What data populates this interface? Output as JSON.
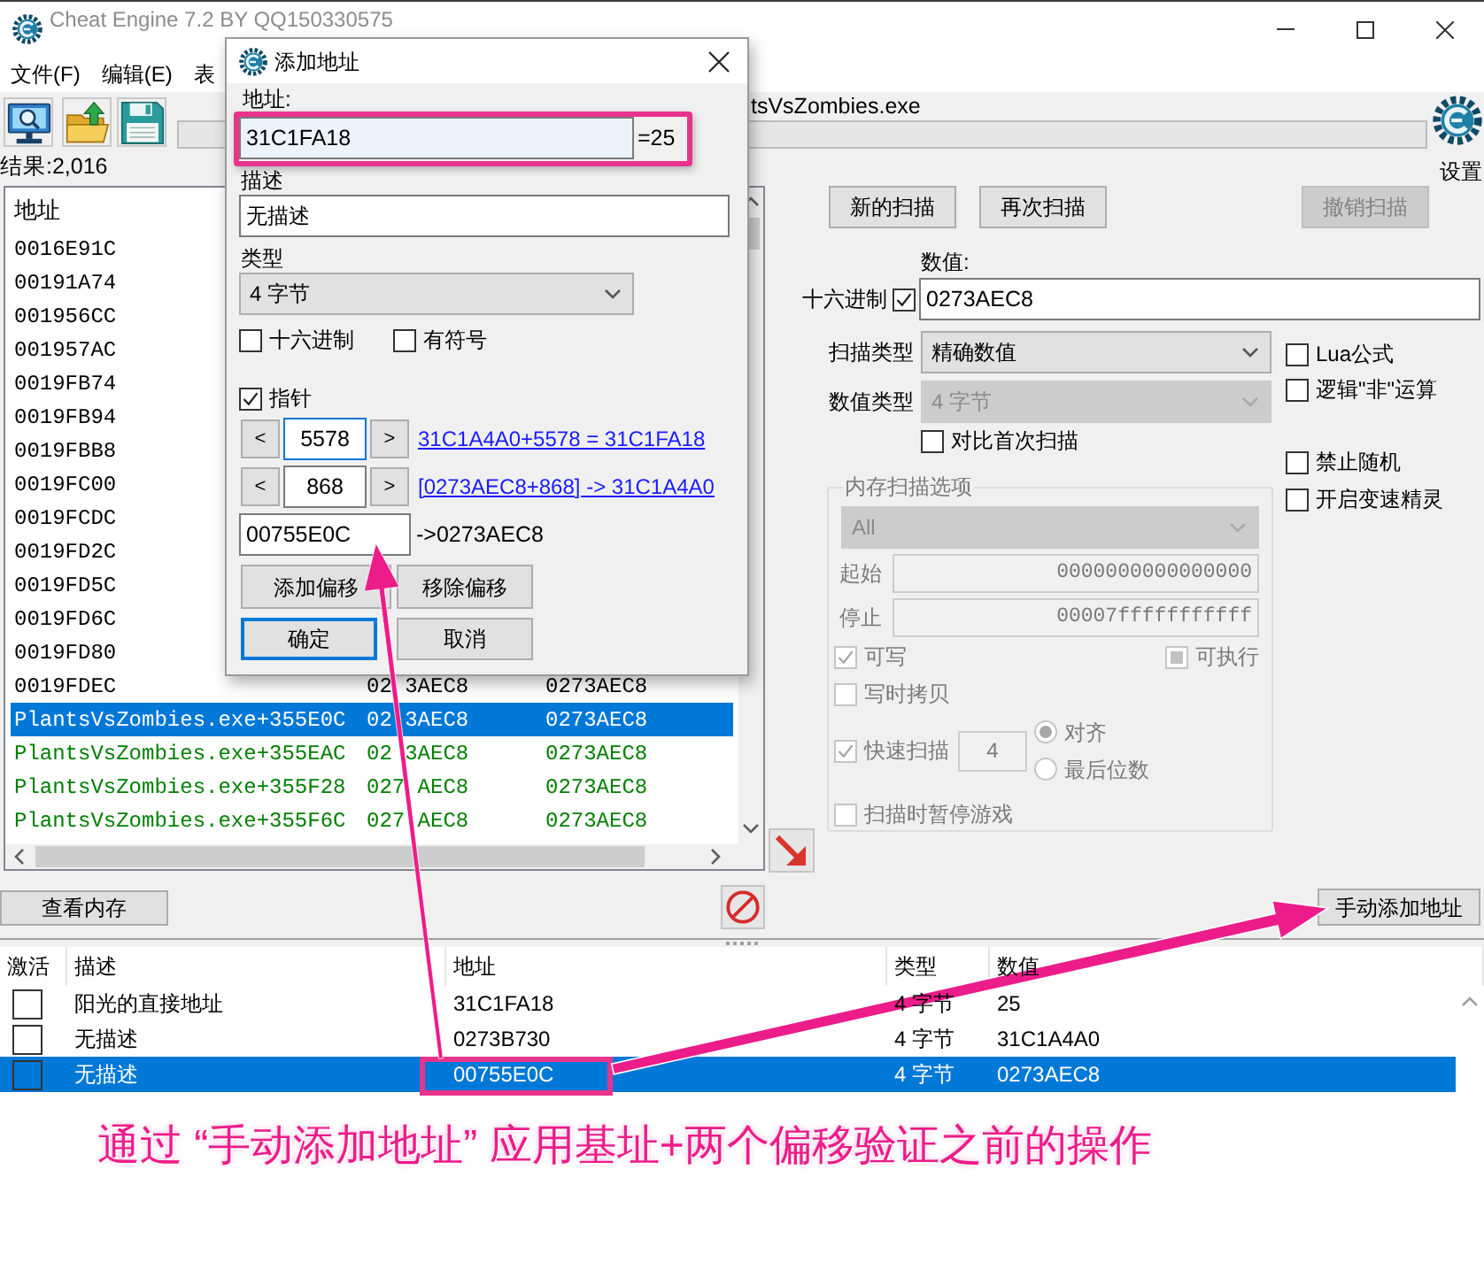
{
  "window": {
    "title": "Cheat Engine 7.2 BY QQ150330575"
  },
  "menu": [
    "文件(F)",
    "编辑(E)",
    "表"
  ],
  "process": {
    "name": "tsVsZombies.exe"
  },
  "progress": {
    "level": 0
  },
  "settings_label": "设置",
  "found": "结果:2,016",
  "results": {
    "columns": [
      "地址"
    ],
    "rows": [
      {
        "address": "0016E91C",
        "kind": "normal",
        "selected": false
      },
      {
        "address": "00191A74",
        "kind": "normal",
        "selected": false
      },
      {
        "address": "001956CC",
        "kind": "normal",
        "selected": false
      },
      {
        "address": "001957AC",
        "kind": "normal",
        "selected": false
      },
      {
        "address": "0019FB74",
        "kind": "normal",
        "selected": false
      },
      {
        "address": "0019FB94",
        "kind": "normal",
        "selected": false
      },
      {
        "address": "0019FBB8",
        "kind": "normal",
        "selected": false
      },
      {
        "address": "0019FC00",
        "kind": "normal",
        "selected": false
      },
      {
        "address": "0019FCDC",
        "kind": "normal",
        "selected": false
      },
      {
        "address": "0019FD2C",
        "kind": "normal",
        "selected": false
      },
      {
        "address": "0019FD5C",
        "kind": "normal",
        "selected": false
      },
      {
        "address": "0019FD6C",
        "kind": "normal",
        "selected": false
      },
      {
        "address": "0019FD80",
        "kind": "normal",
        "selected": false
      },
      {
        "address": "0019FDEC",
        "value_parts": [
          "02",
          "3AEC8"
        ],
        "previous": "0273AEC8",
        "kind": "normal",
        "selected": false
      },
      {
        "address": "PlantsVsZombies.exe+355E0C",
        "value_parts": [
          "02",
          "3AEC8"
        ],
        "previous": "0273AEC8",
        "selected": true
      },
      {
        "address": "PlantsVsZombies.exe+355EAC",
        "value_parts": [
          "02",
          "3AEC8"
        ],
        "previous": "0273AEC8",
        "kind": "static",
        "selected": false
      },
      {
        "address": "PlantsVsZombies.exe+355F28",
        "value_parts": [
          "027",
          "AEC8"
        ],
        "previous": "0273AEC8",
        "kind": "static",
        "selected": false
      },
      {
        "address": "PlantsVsZombies.exe+355F6C",
        "value_parts": [
          "027",
          "AEC8"
        ],
        "previous": "0273AEC8",
        "kind": "static",
        "selected": false
      }
    ]
  },
  "view_memory": "查看内存",
  "add_address": "手动添加地址",
  "scan": {
    "buttons": [
      {
        "label": "新的扫描",
        "disabled": false
      },
      {
        "label": "再次扫描",
        "disabled": false
      },
      {
        "label": "撤销扫描",
        "disabled": true
      }
    ],
    "value_label": "数值:",
    "hex": {
      "label": "十六进制",
      "checked": true
    },
    "value": "0273AEC8",
    "scan_type": {
      "label": "扫描类型",
      "value": "精确数值",
      "disabled": false
    },
    "value_type": {
      "label": "数值类型",
      "value": "4 字节",
      "disabled": true
    },
    "compare_first": {
      "label": "对比首次扫描",
      "checked": false
    },
    "option_groups": [
      [
        {
          "label": "Lua公式",
          "checked": false
        },
        {
          "label": "逻辑\"非\"运算",
          "checked": false
        }
      ],
      [
        {
          "label": "禁止随机",
          "checked": false
        },
        {
          "label": "开启变速精灵",
          "checked": false
        }
      ]
    ],
    "memory_options": {
      "title": "内存扫描选项",
      "disabled": true,
      "region": "All",
      "start_label": "起始",
      "start": "0000000000000000",
      "stop_label": "停止",
      "stop": "00007fffffffffff",
      "writable": {
        "label": "可写",
        "checked": true
      },
      "executable": {
        "label": "可执行",
        "checked": false,
        "partial": true
      },
      "copy_on_write": {
        "label": "写时拷贝",
        "checked": false
      },
      "fast_scan": {
        "label": "快速扫描",
        "checked": true,
        "value": "4"
      },
      "alignment": [
        {
          "label": "对齐",
          "selected": true
        },
        {
          "label": "最后位数",
          "selected": false
        }
      ],
      "pause_game": {
        "label": "扫描时暂停游戏",
        "checked": false
      }
    }
  },
  "dialog": {
    "title": "添加地址",
    "address_label": "地址:",
    "address": "31C1FA18",
    "address_value": "=25",
    "description_label": "描述",
    "description": "无描述",
    "type_label": "类型",
    "type": "4 字节",
    "flags": [
      {
        "label": "十六进制",
        "checked": false
      },
      {
        "label": "有符号",
        "checked": false
      }
    ],
    "pointer": {
      "label": "指针",
      "checked": true
    },
    "offsets": [
      {
        "decrement": "<",
        "value": "5578",
        "increment": ">",
        "result": "31C1A4A0+5578 = 31C1FA18",
        "focused": true
      },
      {
        "decrement": "<",
        "value": "868",
        "increment": ">",
        "result": "[0273AEC8+868] -> 31C1A4A0",
        "focused": false
      }
    ],
    "base": "00755E0C",
    "base_result": "->0273AEC8",
    "buttons": [
      {
        "label": "添加偏移",
        "default": false
      },
      {
        "label": "移除偏移",
        "default": false
      },
      {
        "label": "确定",
        "default": true
      },
      {
        "label": "取消",
        "default": false
      }
    ]
  },
  "address_list": {
    "columns": [
      "激活",
      "描述",
      "地址",
      "类型",
      "数值"
    ],
    "rows": [
      {
        "active": false,
        "description": "阳光的直接地址",
        "address": "31C1FA18",
        "type": "4 字节",
        "value": "25",
        "selected": false
      },
      {
        "active": false,
        "description": "无描述",
        "address": "0273B730",
        "type": "4 字节",
        "value": "31C1A4A0",
        "selected": false
      },
      {
        "active": false,
        "description": "无描述",
        "address": "00755E0C",
        "type": "4 字节",
        "value": "0273AEC8",
        "selected": true
      }
    ]
  },
  "caption": "通过 “手动添加地址” 应用基址+两个偏移验证之前的操作"
}
